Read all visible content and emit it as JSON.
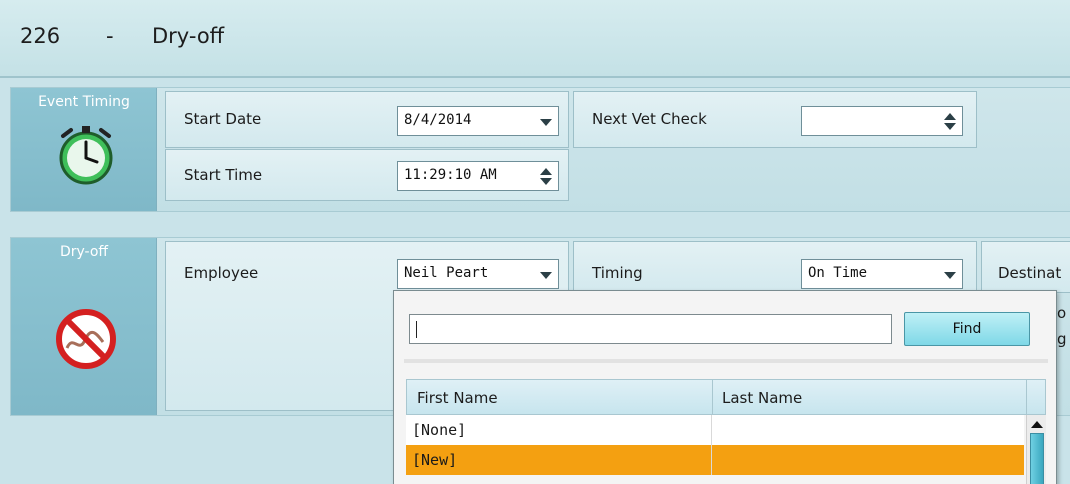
{
  "header": {
    "event_id": "226",
    "separator": "-",
    "event_name": "Dry-off"
  },
  "event_timing": {
    "label": "Event Timing",
    "icon": "stopwatch-icon",
    "start_date": {
      "label": "Start Date",
      "value": "8/4/2014"
    },
    "start_time": {
      "label": "Start Time",
      "value": "11:29:10 AM"
    },
    "next_vet_check": {
      "label": "Next Vet Check",
      "value": ""
    }
  },
  "dry_off": {
    "label": "Dry-off",
    "icon": "no-milking-icon",
    "employee": {
      "label": "Employee",
      "value": "Neil  Peart"
    },
    "timing": {
      "label": "Timing",
      "value": "On Time"
    },
    "destination_label": "Destinat",
    "peek_right_1": "o",
    "peek_right_2": "g"
  },
  "employee_picker": {
    "search_value": "",
    "find_label": "Find",
    "columns": [
      "First Name",
      "Last Name"
    ],
    "rows": [
      {
        "first": "[None]",
        "last": ""
      },
      {
        "first": "[New]",
        "last": ""
      }
    ],
    "selected_row_color": "#f4a011"
  }
}
